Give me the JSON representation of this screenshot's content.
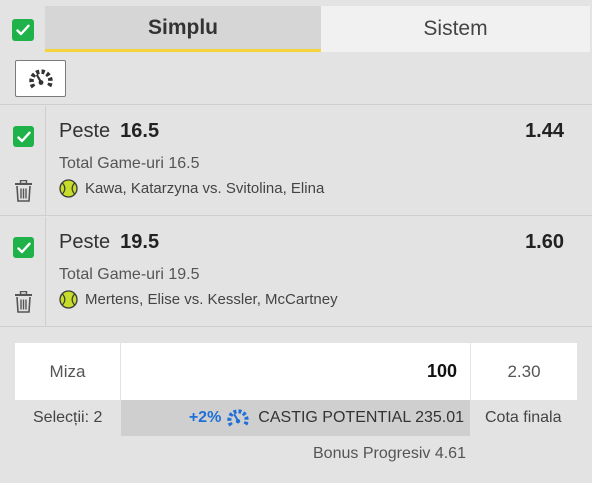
{
  "tabs": {
    "simplu": "Simplu",
    "sistem": "Sistem"
  },
  "colors": {
    "check_green": "#1fb14a",
    "tab_underline": "#f3d43c",
    "bonus_blue": "#1e6fd8",
    "tennis_ball": "#c6dd2a"
  },
  "toolbar": {
    "icon": "gauge-icon"
  },
  "bets": [
    {
      "selection": "Peste",
      "line": "16.5",
      "odds": "1.44",
      "market": "Total Game-uri 16.5",
      "event": "Kawa, Katarzyna vs. Svitolina, Elina",
      "sport_icon": "tennis-ball-icon",
      "checked": true
    },
    {
      "selection": "Peste",
      "line": "19.5",
      "odds": "1.60",
      "market": "Total Game-uri 19.5",
      "event": "Mertens, Elise vs. Kessler, McCartney",
      "sport_icon": "tennis-ball-icon",
      "checked": true
    }
  ],
  "stake": {
    "label": "Miza",
    "value": "100",
    "total_odds": "2.30",
    "selections_label": "Selecții: 2",
    "bonus_percent": "+2%",
    "potential_win": "CASTIG POTENTIAL 235.01",
    "total_odds_label": "Cota finala",
    "bonus_progresiv": "Bonus Progresiv 4.61"
  }
}
